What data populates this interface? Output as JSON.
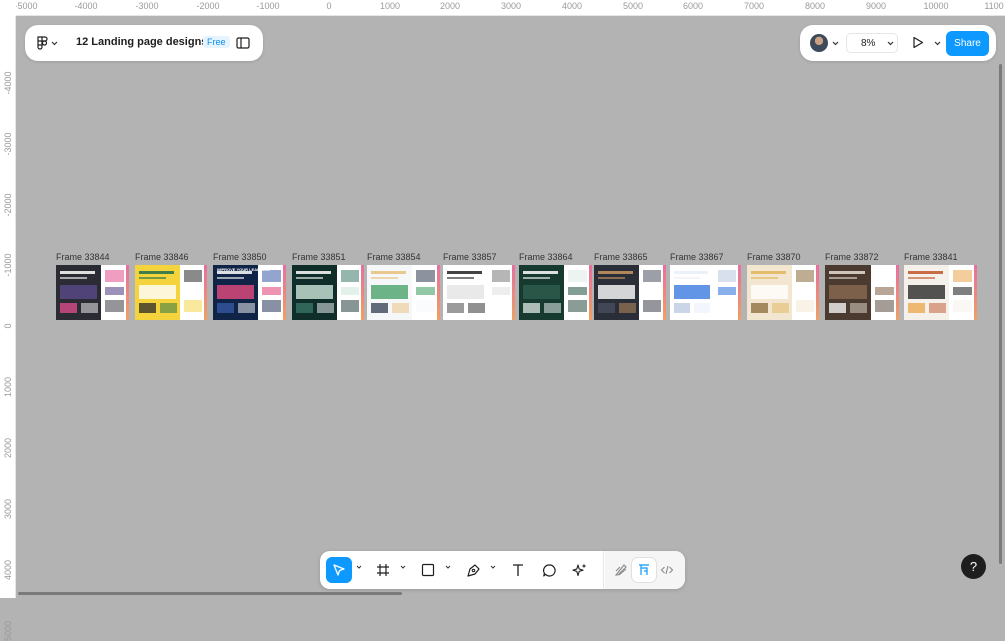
{
  "file": {
    "name": "12 Landing page designs",
    "badge": "Free"
  },
  "header": {
    "zoom": "8%",
    "share_label": "Share"
  },
  "ruler_top": [
    "-5000",
    "-4000",
    "-3000",
    "-2000",
    "-1000",
    "0",
    "1000",
    "2000",
    "3000",
    "4000",
    "5000",
    "6000",
    "7000",
    "8000",
    "9000",
    "10000",
    "1100"
  ],
  "ruler_left": [
    "-4000",
    "-3000",
    "-2000",
    "-1000",
    "0",
    "1000",
    "2000",
    "3000",
    "4000",
    "5000"
  ],
  "frames": [
    {
      "label": "Frame 33844",
      "theme": "dark"
    },
    {
      "label": "Frame 33846",
      "theme": "yellow"
    },
    {
      "label": "Frame 33850",
      "theme": "navy",
      "text": "IMPROVE YOUR LEARNING"
    },
    {
      "label": "Frame 33851",
      "theme": "darkgreen"
    },
    {
      "label": "Frame 33854",
      "theme": "light"
    },
    {
      "label": "Frame 33857",
      "theme": "white"
    },
    {
      "label": "Frame 33864",
      "theme": "forest"
    },
    {
      "label": "Frame 33865",
      "theme": "house"
    },
    {
      "label": "Frame 33867",
      "theme": "app"
    },
    {
      "label": "Frame 33870",
      "theme": "beige"
    },
    {
      "label": "Frame 33872",
      "theme": "brown"
    },
    {
      "label": "Frame 33841",
      "theme": "food"
    }
  ],
  "help": {
    "label": "?"
  },
  "colors": {
    "accent": "#0d99ff",
    "canvas": "#b3b3b3"
  }
}
